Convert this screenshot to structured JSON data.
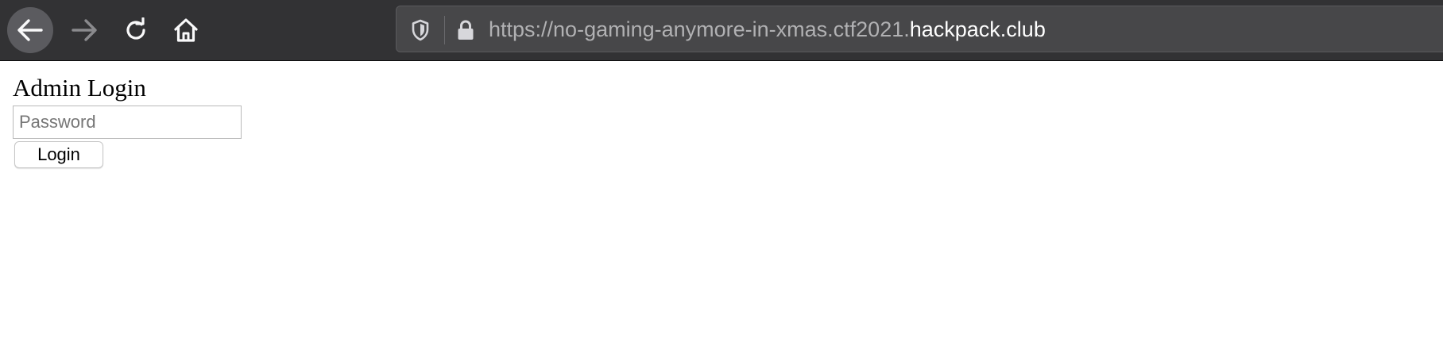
{
  "browser": {
    "icons": {
      "back": "arrow-left-icon",
      "forward": "arrow-right-icon",
      "reload": "reload-icon",
      "home": "home-icon",
      "tracking": "shield-icon",
      "security": "lock-icon"
    },
    "url": {
      "prefix": "https://no-gaming-anymore-in-xmas.ctf2021.",
      "domain": "hackpack.club"
    },
    "colors": {
      "toolbar": "#323234",
      "urlbar": "#474749",
      "url_dim": "#b1b1b3",
      "url_highlight": "#ffffff"
    }
  },
  "page": {
    "title": "Admin Login",
    "password": {
      "placeholder": "Password",
      "value": ""
    },
    "login_label": "Login"
  }
}
